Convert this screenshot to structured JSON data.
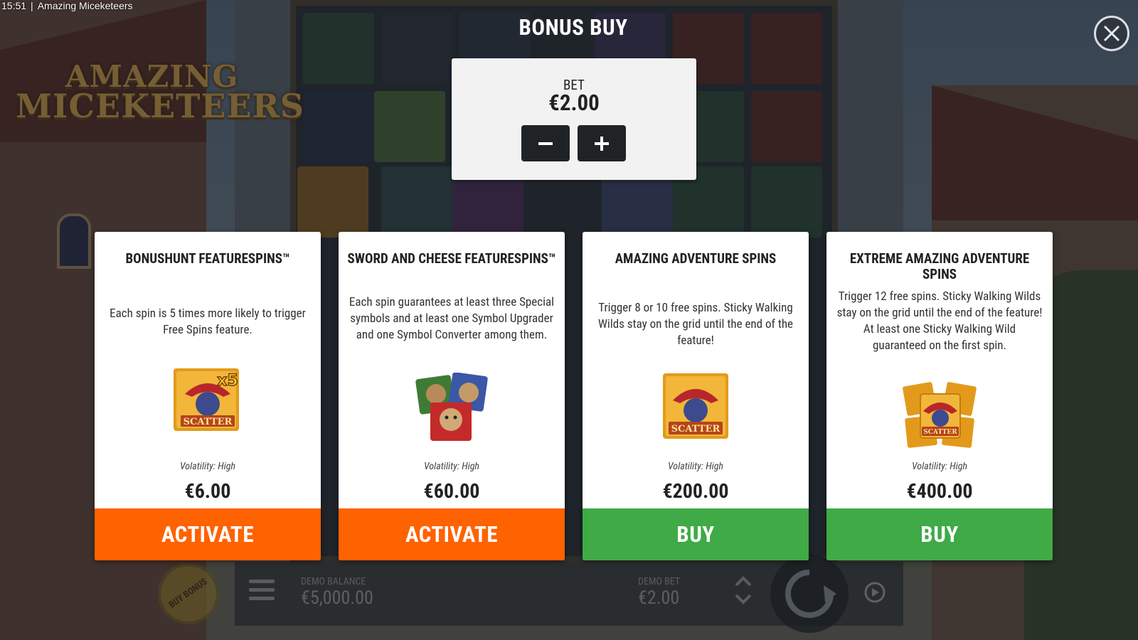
{
  "statusbar": {
    "time": "15:51",
    "app_title": "Amazing Miceketeers"
  },
  "game": {
    "logo_line1": "AMAZING",
    "logo_line2": "MICEKETEERS"
  },
  "dialog": {
    "title": "BONUS BUY",
    "bet": {
      "label": "BET",
      "value": "€2.00",
      "decrease": "−",
      "increase": "+"
    },
    "cards": [
      {
        "title": "BONUSHUNT FEATURESPINS™",
        "description": "Each spin is 5 times more likely to trigger Free Spins feature.",
        "image_badge": "x5",
        "image_text": "SCATTER",
        "volatility": "Volatility: High",
        "price": "€6.00",
        "button": "ACTIVATE",
        "button_color": "#ff6200"
      },
      {
        "title": "SWORD AND CHEESE FEATURESPINS™",
        "description": "Each spin guarantees at least three Special symbols and at least one Symbol Upgrader and one Symbol Converter among them.",
        "volatility": "Volatility: High",
        "price": "€60.00",
        "button": "ACTIVATE",
        "button_color": "#ff6200"
      },
      {
        "title": "AMAZING ADVENTURE SPINS",
        "description": "Trigger 8 or 10 free spins. Sticky Walking Wilds stay on the grid until the end of the feature!",
        "image_text": "SCATTER",
        "volatility": "Volatility: High",
        "price": "€200.00",
        "button": "BUY",
        "button_color": "#3faa46"
      },
      {
        "title": "EXTREME AMAZING ADVENTURE SPINS",
        "description": "Trigger 12 free spins. Sticky Walking Wilds stay on the grid until the end of the feature! At least one Sticky Walking Wild guaranteed on the first spin.",
        "image_text": "SCATTER",
        "volatility": "Volatility: High",
        "price": "€400.00",
        "button": "BUY",
        "button_color": "#3faa46"
      }
    ]
  },
  "bottom_bar": {
    "buy_bonus": "BUY BONUS",
    "demo_balance_label": "DEMO BALANCE",
    "demo_balance_value": "€5,000.00",
    "demo_bet_label": "DEMO BET",
    "demo_bet_value": "€2.00"
  },
  "icons": {
    "close": "close-icon",
    "menu": "menu-icon",
    "spin": "spin-icon",
    "autoplay": "autoplay-icon",
    "bet_adjust": "chevron-up-down-icon"
  },
  "colors": {
    "activate": "#ff6200",
    "buy": "#3faa46",
    "panel": "#f2f2f2"
  }
}
